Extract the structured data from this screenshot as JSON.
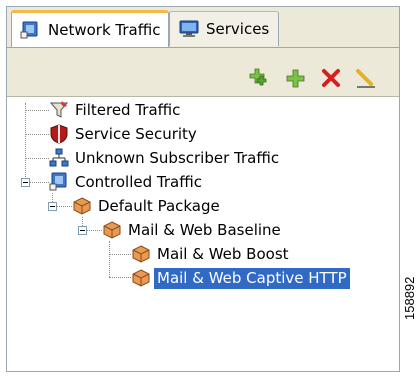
{
  "tabs": [
    {
      "label": "Network Traffic",
      "icon": "network-traffic-icon",
      "active": true
    },
    {
      "label": "Services",
      "icon": "monitor-icon",
      "active": false
    }
  ],
  "toolbar": {
    "buttons": [
      {
        "name": "add-multiple-button",
        "icon": "add-multiple-icon"
      },
      {
        "name": "add-button",
        "icon": "add-icon"
      },
      {
        "name": "delete-button",
        "icon": "delete-icon"
      },
      {
        "name": "edit-button",
        "icon": "edit-pencil-icon"
      }
    ]
  },
  "tree": {
    "nodes": [
      {
        "label": "Filtered Traffic",
        "icon": "filter-icon"
      },
      {
        "label": "Service Security",
        "icon": "shield-icon"
      },
      {
        "label": "Unknown Subscriber Traffic",
        "icon": "subscriber-network-icon"
      },
      {
        "label": "Controlled Traffic",
        "icon": "network-traffic-icon",
        "expanded": true
      },
      {
        "label": "Default Package",
        "icon": "package-icon",
        "expanded": true
      },
      {
        "label": "Mail & Web Baseline",
        "icon": "package-icon",
        "expanded": true
      },
      {
        "label": "Mail & Web Boost",
        "icon": "package-icon"
      },
      {
        "label": "Mail & Web Captive HTTP",
        "icon": "package-icon",
        "selected": true
      }
    ]
  },
  "figure_number": "158892",
  "colors": {
    "selection": "#316ac5",
    "tab_accent": "#f7b84a",
    "toolbar_bg": "#ece9d8"
  }
}
